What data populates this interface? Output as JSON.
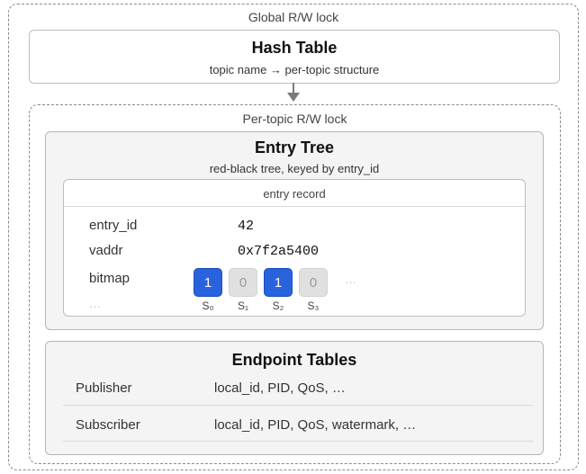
{
  "global_lock": {
    "label": "Global R/W lock"
  },
  "hash_table": {
    "title": "Hash Table",
    "subtitle": "topic name → per-topic structure"
  },
  "per_topic_lock": {
    "label": "Per-topic R/W lock"
  },
  "entry_tree": {
    "title": "Entry Tree",
    "subtitle": "red-black tree, keyed by entry_id",
    "record": {
      "header": "entry record",
      "fields": [
        {
          "name": "entry_id",
          "value": "42"
        },
        {
          "name": "vaddr",
          "value": "0x7f2a5400"
        }
      ],
      "bitmap": {
        "label": "bitmap",
        "bits": [
          {
            "value": "1",
            "set": true,
            "slot": "S₀"
          },
          {
            "value": "0",
            "set": false,
            "slot": "S₁"
          },
          {
            "value": "1",
            "set": true,
            "slot": "S₂"
          },
          {
            "value": "0",
            "set": false,
            "slot": "S₃"
          }
        ],
        "more": "···"
      },
      "more_fields": "…"
    }
  },
  "endpoint_tables": {
    "title": "Endpoint Tables",
    "rows": [
      {
        "name": "Publisher",
        "fields": "local_id, PID, QoS, …"
      },
      {
        "name": "Subscriber",
        "fields": "local_id, PID, QoS, watermark, …"
      }
    ]
  },
  "colors": {
    "bit_set": "#2962dd",
    "bit_clear": "#e0e0e0",
    "dashed_border": "#8a8a8a"
  }
}
